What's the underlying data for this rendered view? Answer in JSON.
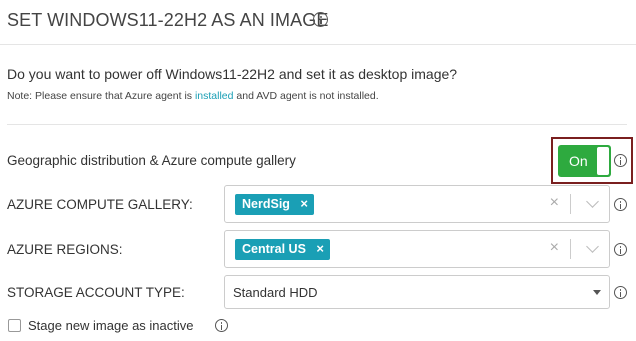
{
  "header": {
    "title": "SET WINDOWS11-22H2 AS AN IMAGE",
    "info_icon": "info-icon"
  },
  "prompt": {
    "question": "Do you want to power off Windows11-22H2 and set it as desktop image?",
    "note_before": "Note: Please ensure that Azure agent is ",
    "note_link": "installed",
    "note_after": " and AVD agent is not installed."
  },
  "geo": {
    "label": "Geographic distribution & Azure compute gallery",
    "toggle_label": "On",
    "toggle_state": true,
    "toggle_color": "#2eaa3f"
  },
  "gallery": {
    "label": "AZURE COMPUTE GALLERY:",
    "chips": [
      "NerdSig"
    ],
    "chip_remove": "×",
    "clear": "×"
  },
  "regions": {
    "label": "AZURE REGIONS:",
    "chips": [
      "Central US"
    ],
    "chip_remove": "×",
    "clear": "×"
  },
  "storage": {
    "label": "STORAGE ACCOUNT TYPE:",
    "value": "Standard HDD"
  },
  "stage": {
    "label": "Stage new image as inactive",
    "checked": false
  },
  "colors": {
    "accent": "#1a9fb5",
    "toggle_on": "#2eaa3f",
    "highlight_border": "#7a1f1f"
  }
}
